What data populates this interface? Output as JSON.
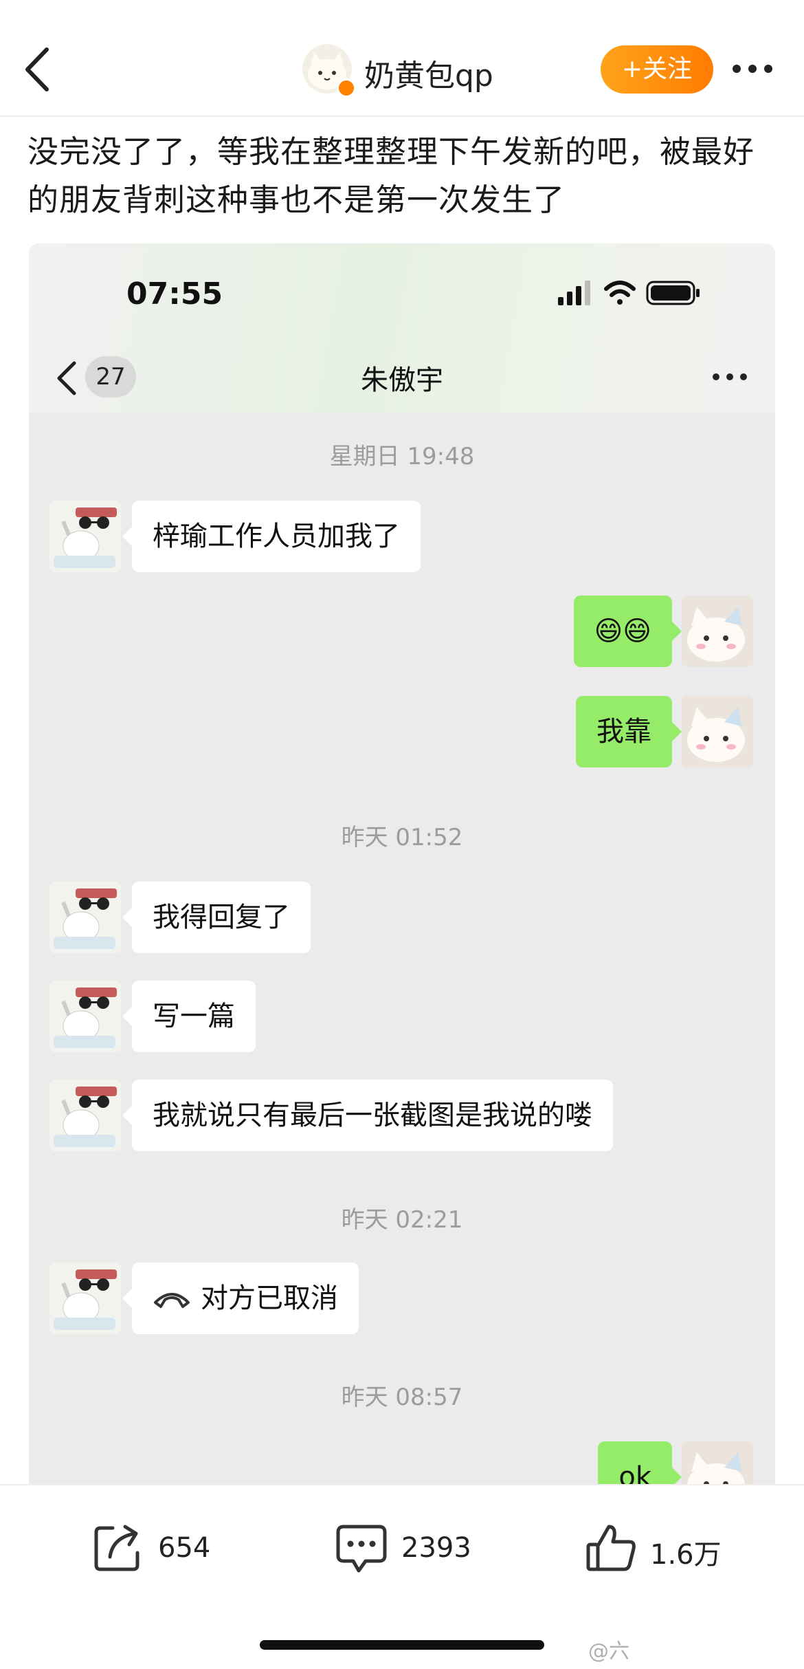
{
  "header": {
    "author_name": "奶黄包qp",
    "follow_label": "+关注",
    "icons": [
      "back-arrow-icon",
      "verified-badge-icon",
      "more-dots-icon"
    ],
    "accent_color": "#ff8200"
  },
  "post": {
    "text": "没完没了了，等我在整理整理下午发新的吧，被最好的朋友背刺这种事也不是第一次发生了"
  },
  "chat_screenshot": {
    "status_time": "07:55",
    "unread_count": "27",
    "contact_name": "朱傲宇",
    "colors": {
      "sent_bubble": "#95ec69",
      "received_bubble": "#ffffff",
      "chat_bg": "#ebebeb"
    },
    "timestamps": [
      "星期日 19:48",
      "昨天 01:52",
      "昨天 02:21",
      "昨天 08:57"
    ],
    "messages": [
      {
        "side": "left",
        "text": "梓瑜工作人员加我了"
      },
      {
        "side": "right",
        "text": "😄😄"
      },
      {
        "side": "right",
        "text": "我靠"
      },
      {
        "side": "left",
        "text": "我得回复了"
      },
      {
        "side": "left",
        "text": "写一篇"
      },
      {
        "side": "left",
        "text": "我就说只有最后一张截图是我说的喽"
      },
      {
        "side": "left",
        "text": "对方已取消",
        "icon": "call-cancel-icon"
      },
      {
        "side": "right",
        "text": "ok"
      }
    ]
  },
  "actions": {
    "repost_count": "654",
    "comment_count": "2393",
    "like_count": "1.6万"
  },
  "watermark": "@六"
}
